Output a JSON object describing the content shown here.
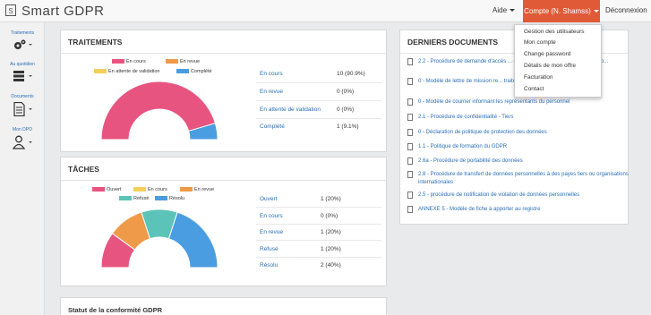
{
  "app": {
    "logo_letter": "S",
    "title": "Smart GDPR"
  },
  "nav": {
    "aide": "Aide",
    "compte": "Compte (N. Shamss)",
    "deconnexion": "Déconnexion"
  },
  "sidebar": {
    "items": [
      {
        "label": "Traitements",
        "icon": "gears-icon"
      },
      {
        "label": "Au quotidien",
        "icon": "database-icon"
      },
      {
        "label": "Documents",
        "icon": "document-icon"
      },
      {
        "label": "Mon DPO",
        "icon": "user-icon"
      }
    ]
  },
  "dropdown": {
    "items": [
      "Gestion des utilisateurs",
      "Mon compte",
      "Change password",
      "Détails de mon offre",
      "Facturation",
      "Contact"
    ]
  },
  "traitements": {
    "title": "TRAITEMENTS",
    "legend": [
      {
        "label": "En cours",
        "color": "#e75480"
      },
      {
        "label": "En revue",
        "color": "#ef9a48"
      },
      {
        "label": "En attente de validation",
        "color": "#f3cf5b"
      },
      {
        "label": "Complété",
        "color": "#4a9de0"
      }
    ],
    "stats": [
      {
        "label": "En cours",
        "value": "10 (90.9%)"
      },
      {
        "label": "En revue",
        "value": "0 (0%)"
      },
      {
        "label": "En attente de validation",
        "value": "0 (0%)"
      },
      {
        "label": "Complété",
        "value": "1 (9.1%)"
      }
    ],
    "chart_data": {
      "type": "pie",
      "categories": [
        "En cours",
        "En revue",
        "En attente de validation",
        "Complété"
      ],
      "values": [
        10,
        0,
        0,
        1
      ]
    }
  },
  "taches": {
    "title": "TÂCHES",
    "legend": [
      {
        "label": "Ouvert",
        "color": "#e75480"
      },
      {
        "label": "En cours",
        "color": "#f3cf5b"
      },
      {
        "label": "En revue",
        "color": "#ef9a48"
      },
      {
        "label": "Refusé",
        "color": "#5cc3b8"
      },
      {
        "label": "Résolu",
        "color": "#4a9de0"
      }
    ],
    "stats": [
      {
        "label": "Ouvert",
        "value": "1 (20%)"
      },
      {
        "label": "En cours",
        "value": "0 (0%)"
      },
      {
        "label": "En revue",
        "value": "1 (20%)"
      },
      {
        "label": "Refusé",
        "value": "1 (20%)"
      },
      {
        "label": "Résolu",
        "value": "2 (40%)"
      }
    ],
    "chart_data": {
      "type": "pie",
      "categories": [
        "Ouvert",
        "En cours",
        "En revue",
        "Refusé",
        "Résolu"
      ],
      "values": [
        1,
        0,
        1,
        1,
        2
      ]
    }
  },
  "documents": {
    "title": "DERNIERS DOCUMENTS",
    "items": [
      "2.2 - Procédure de demande d'accès ... concernée par le traitement de ses do...",
      "0 - Modèle de lettre de mission re... traitements",
      "0 - Modèle de courrier informant les représentants du personnel",
      "2.1 - Procédure de confidentialité - Tiers",
      "0 - Déclaration de politique de protection des données",
      "1.1 - Politique de formation du GDPR",
      "2.6a - Procédure de portabilité des données",
      "2.8 - Procédure de transfert de données personnelles à des payes tiers ou organisations internationales",
      "2.5 - procédure de notification de violation de données personnelles",
      "ANNEXE 5 - Modèle de fiche à apporter au registre"
    ]
  },
  "statut": {
    "title": "Statut de la conformité GDPR"
  }
}
